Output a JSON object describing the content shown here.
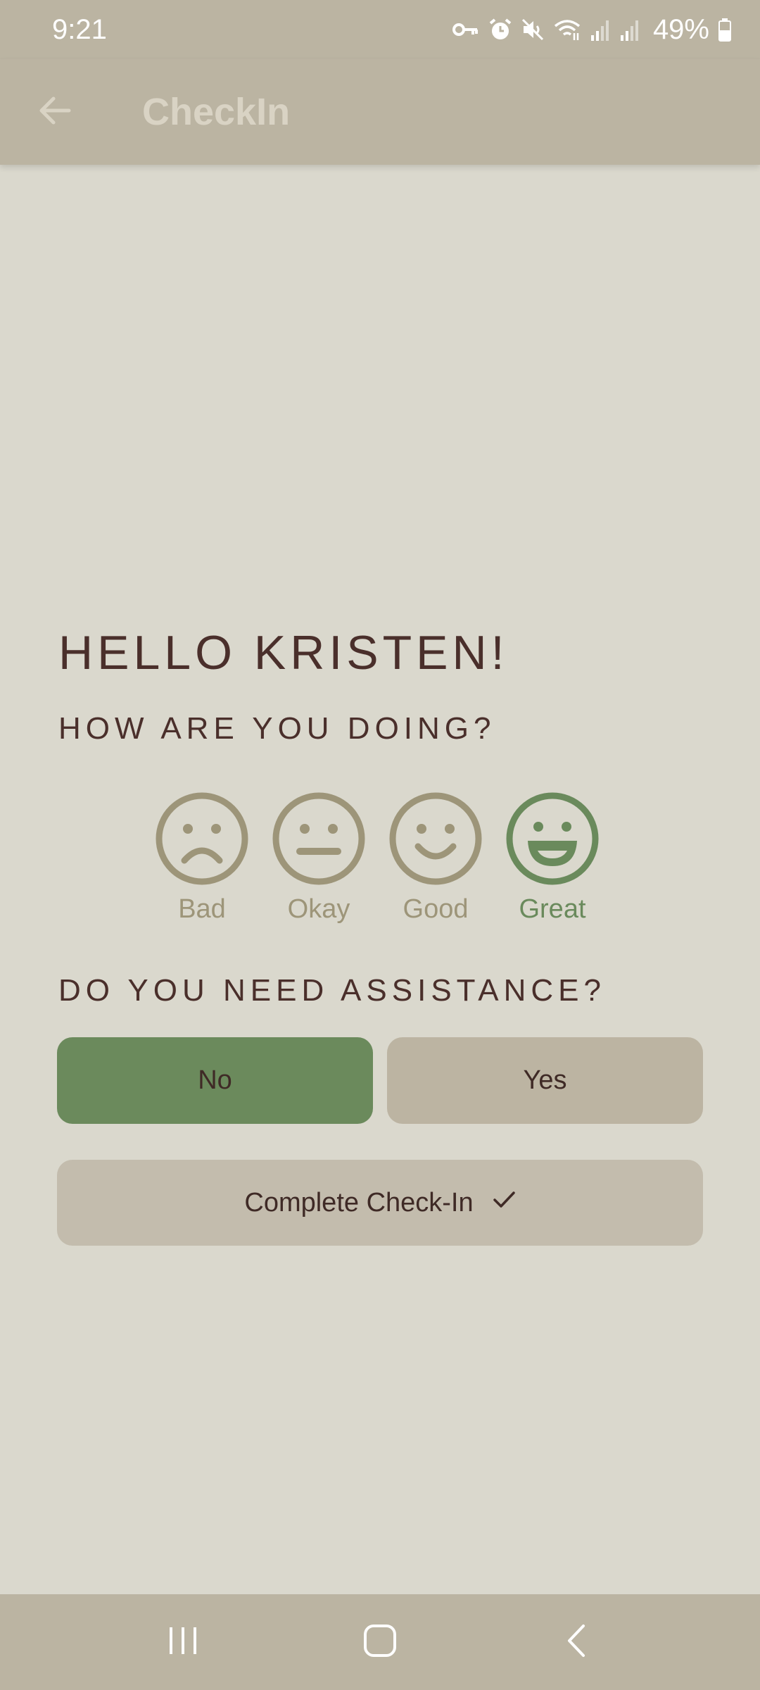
{
  "status_bar": {
    "time": "9:21",
    "battery": "49%",
    "icons": [
      "vpn-key-icon",
      "alarm-icon",
      "mute-icon",
      "wifi-icon",
      "signal-icon",
      "signal-icon",
      "battery-icon"
    ]
  },
  "app_bar": {
    "title": "CheckIn",
    "back_icon": "arrow-back-icon"
  },
  "main": {
    "greeting": "HELLO KRISTEN!",
    "mood_question": "HOW ARE YOU DOING?",
    "moods": [
      {
        "label": "Bad",
        "icon": "sad-face-icon",
        "selected": false
      },
      {
        "label": "Okay",
        "icon": "neutral-face-icon",
        "selected": false
      },
      {
        "label": "Good",
        "icon": "smile-face-icon",
        "selected": false
      },
      {
        "label": "Great",
        "icon": "grin-face-icon",
        "selected": true
      }
    ],
    "assistance_question": "DO YOU NEED ASSISTANCE?",
    "assistance_options": [
      {
        "label": "No",
        "selected": true
      },
      {
        "label": "Yes",
        "selected": false
      }
    ],
    "complete_button": {
      "label": "Complete Check-In",
      "icon": "check-icon"
    }
  },
  "colors": {
    "background": "#dad8cd",
    "bar": "#bbb4a2",
    "accent_green": "#6b8a5c",
    "mood_inactive": "#9d9579",
    "text_dark": "#4a2f2b"
  },
  "nav_bar": {
    "buttons": [
      "recent-apps-icon",
      "home-icon",
      "back-icon"
    ]
  }
}
